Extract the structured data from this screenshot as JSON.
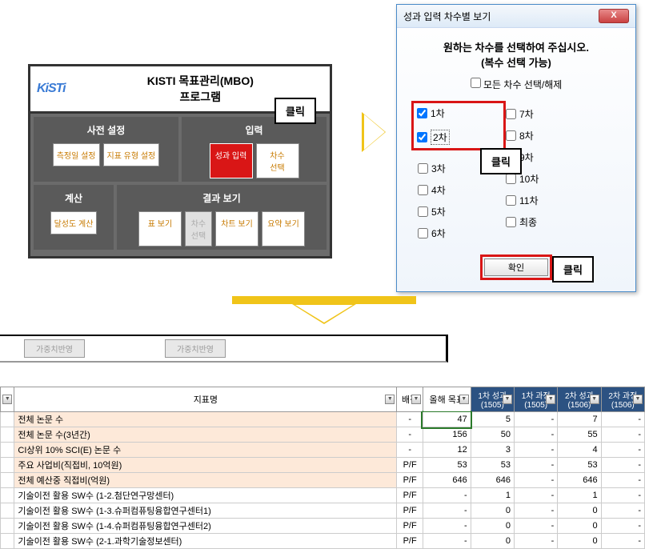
{
  "kisti": {
    "logo_text": "KiSTi",
    "title": "KISTI 목표관리(MBO)\n프로그램",
    "section_presets": "사전 설정",
    "btn_measure_date": "측정일 설정",
    "btn_indicator_type": "지표 유형 설정",
    "section_input": "입력",
    "btn_result_input": "성과 입력",
    "btn_round_select": "차수\n선택",
    "section_calc": "계산",
    "btn_achievement_calc": "달성도 계산",
    "section_view": "결과 보기",
    "btn_table_view": "표 보기",
    "btn_round_select_grey": "차수\n선택",
    "btn_chart_view": "차트 보기",
    "btn_summary_view": "요약 보기"
  },
  "callout": {
    "click": "클릭"
  },
  "dialog": {
    "title": "성과 입력 차수별 보기",
    "close": "X",
    "message1": "원하는 차수를 선택하여 주십시오.",
    "message2": "(복수 선택 가능)",
    "select_all": "모든 차수 선택/해제",
    "rounds_left": [
      {
        "label": "1차",
        "checked": true
      },
      {
        "label": "2차",
        "checked": true
      },
      {
        "label": "3차",
        "checked": false
      },
      {
        "label": "4차",
        "checked": false
      },
      {
        "label": "5차",
        "checked": false
      },
      {
        "label": "6차",
        "checked": false
      }
    ],
    "rounds_right": [
      {
        "label": "7차",
        "checked": false
      },
      {
        "label": "8차",
        "checked": false
      },
      {
        "label": "9차",
        "checked": false
      },
      {
        "label": "10차",
        "checked": false
      },
      {
        "label": "11차",
        "checked": false
      },
      {
        "label": "최종",
        "checked": false
      }
    ],
    "ok": "확인"
  },
  "grid": {
    "frag_btn": "가중치반영",
    "headers": {
      "indicator_name": "지표명",
      "score": "배점",
      "year_target": "올해 목표",
      "result1": "1차 성과\n(1505)",
      "process1": "1차 과정\n(1505)",
      "result2": "2차 성과\n(1506)",
      "process2": "2차 과정\n(1506)"
    },
    "rows": [
      {
        "name": "전체 논문 수",
        "plain": false,
        "score": "-",
        "target": "47",
        "r1": "5",
        "p1": "-",
        "r2": "7",
        "p2": "-",
        "selected_target": true
      },
      {
        "name": "전체 논문 수(3년간)",
        "plain": false,
        "score": "-",
        "target": "156",
        "r1": "50",
        "p1": "-",
        "r2": "55",
        "p2": "-"
      },
      {
        "name": "CI상위 10% SCI(E) 논문 수",
        "plain": false,
        "score": "-",
        "target": "12",
        "r1": "3",
        "p1": "-",
        "r2": "4",
        "p2": "-"
      },
      {
        "name": "주요 사업비(직접비, 10억원)",
        "plain": false,
        "score": "P/F",
        "target": "53",
        "r1": "53",
        "p1": "-",
        "r2": "53",
        "p2": "-"
      },
      {
        "name": "전체 예산중 직접비(억원)",
        "plain": false,
        "score": "P/F",
        "target": "646",
        "r1": "646",
        "p1": "-",
        "r2": "646",
        "p2": "-"
      },
      {
        "name": "기술이전 활용 SW수 (1-2.첨단연구망센터)",
        "plain": true,
        "score": "P/F",
        "target": "-",
        "r1": "1",
        "p1": "-",
        "r2": "1",
        "p2": "-"
      },
      {
        "name": "기술이전 활용 SW수 (1-3.슈퍼컴퓨팅융합연구센터1)",
        "plain": true,
        "score": "P/F",
        "target": "-",
        "r1": "0",
        "p1": "-",
        "r2": "0",
        "p2": "-"
      },
      {
        "name": "기술이전 활용 SW수 (1-4.슈퍼컴퓨팅융합연구센터2)",
        "plain": true,
        "score": "P/F",
        "target": "-",
        "r1": "0",
        "p1": "-",
        "r2": "0",
        "p2": "-"
      },
      {
        "name": "기술이전 활용 SW수 (2-1.과학기술정보센터)",
        "plain": true,
        "score": "P/F",
        "target": "-",
        "r1": "0",
        "p1": "-",
        "r2": "0",
        "p2": "-"
      }
    ]
  }
}
